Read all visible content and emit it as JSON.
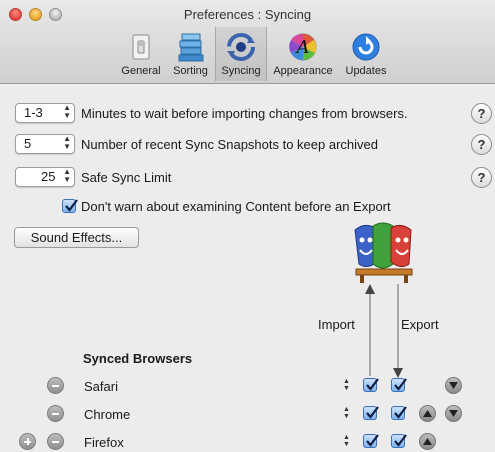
{
  "window": {
    "title": "Preferences : Syncing"
  },
  "toolbar": {
    "items": [
      {
        "label": "General",
        "icon": "light-switch-icon"
      },
      {
        "label": "Sorting",
        "icon": "stack-icon"
      },
      {
        "label": "Syncing",
        "icon": "sync-icon",
        "selected": true
      },
      {
        "label": "Appearance",
        "icon": "color-wheel-icon"
      },
      {
        "label": "Updates",
        "icon": "update-icon"
      }
    ]
  },
  "settings": {
    "minutes_value": "1-3",
    "minutes_label": "Minutes to wait before importing changes from browsers.",
    "snapshots_value": "5",
    "snapshots_label": "Number of recent Sync Snapshots to keep archived",
    "safe_limit_value": "25",
    "safe_limit_label": "Safe Sync Limit",
    "dont_warn_label": "Don't warn about examining Content before an Export",
    "dont_warn_checked": true,
    "help_label": "?"
  },
  "sound_effects_button": "Sound Effects...",
  "sync_diagram": {
    "import_label": "Import",
    "export_label": "Export"
  },
  "synced_browsers": {
    "heading": "Synced Browsers",
    "rows": [
      {
        "name": "Safari",
        "import": true,
        "export": true
      },
      {
        "name": "Chrome",
        "import": true,
        "export": true
      },
      {
        "name": "Firefox",
        "import": true,
        "export": true
      }
    ]
  },
  "colors": {
    "accent": "#3d6fb8",
    "window_bg": "#ececec"
  }
}
